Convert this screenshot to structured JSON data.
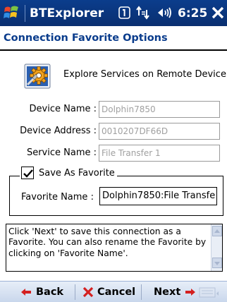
{
  "titlebar": {
    "app_title": "BTExplorer",
    "time": "6:25",
    "icons": [
      "windows-start-icon",
      "notification-icon",
      "connectivity-icon",
      "volume-icon",
      "close-icon"
    ]
  },
  "header": {
    "title": "Connection Favorite Options"
  },
  "explore": {
    "label": "Explore Services on Remote Device",
    "icon": "gear-icon"
  },
  "fields": {
    "device_name": {
      "label": "Device Name :",
      "value": "Dolphin7850"
    },
    "device_address": {
      "label": "Device Address :",
      "value": "0010207DF66D"
    },
    "service_name": {
      "label": "Service Name :",
      "value": "File Transfer 1"
    }
  },
  "favorite": {
    "checkbox_label": "Save As Favorite",
    "checked": true,
    "name_label": "Favorite Name :",
    "name_value": "Dolphin7850:File Transfe"
  },
  "info": {
    "text": "Click 'Next' to save this connection as a Favorite.  You can also rename the Favorite by clicking on 'Favorite Name'."
  },
  "bottombar": {
    "back_label": "Back",
    "cancel_label": "Cancel",
    "next_label": "Next"
  },
  "colors": {
    "titlebar": "#0b3d8c",
    "header_text": "#0a3c8c",
    "arrow_red": "#d42020",
    "disabled_text": "#a0a0a0"
  }
}
